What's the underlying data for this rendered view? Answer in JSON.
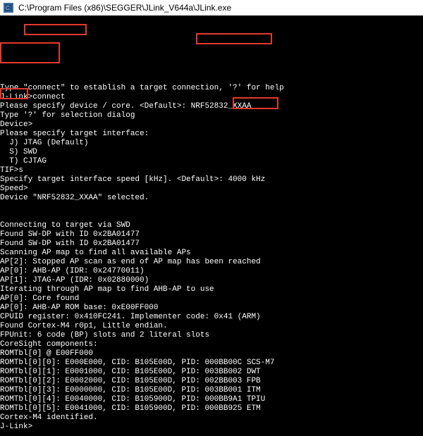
{
  "window": {
    "title": "C:\\Program Files (x86)\\SEGGER\\JLink_V644a\\JLink.exe"
  },
  "terminal": {
    "lines": [
      "",
      "Type \"connect\" to establish a target connection, '?' for help",
      "J-Link>connect",
      "Please specify device / core. <Default>: NRF52832_XXAA",
      "Type '?' for selection dialog",
      "Device>",
      "Please specify target interface:",
      "  J) JTAG (Default)",
      "  S) SWD",
      "  T) CJTAG",
      "TIF>s",
      "Specify target interface speed [kHz]. <Default>: 4000 kHz",
      "Speed>",
      "Device \"NRF52832_XXAA\" selected.",
      "",
      "",
      "Connecting to target via SWD",
      "Found SW-DP with ID 0x2BA01477",
      "Found SW-DP with ID 0x2BA01477",
      "Scanning AP map to find all available APs",
      "AP[2]: Stopped AP scan as end of AP map has been reached",
      "AP[0]: AHB-AP (IDR: 0x24770011)",
      "AP[1]: JTAG-AP (IDR: 0x02880000)",
      "Iterating through AP map to find AHB-AP to use",
      "AP[0]: Core found",
      "AP[0]: AHB-AP ROM base: 0xE00FF000",
      "CPUID register: 0x410FC241. Implementer code: 0x41 (ARM)",
      "Found Cortex-M4 r0p1, Little endian.",
      "FPUnit: 6 code (BP) slots and 2 literal slots",
      "CoreSight components:",
      "ROMTbl[0] @ E00FF000",
      "ROMTbl[0][0]: E000E000, CID: B105E00D, PID: 000BB00C SCS-M7",
      "ROMTbl[0][1]: E0001000, CID: B105E00D, PID: 003BB002 DWT",
      "ROMTbl[0][2]: E0002000, CID: B105E00D, PID: 002BB003 FPB",
      "ROMTbl[0][3]: E0000000, CID: B105E00D, PID: 003BB001 ITM",
      "ROMTbl[0][4]: E0040000, CID: B105900D, PID: 000BB9A1 TPIU",
      "ROMTbl[0][5]: E0041000, CID: B105900D, PID: 000BB925 ETM",
      "Cortex-M4 identified.",
      "J-Link>"
    ]
  }
}
